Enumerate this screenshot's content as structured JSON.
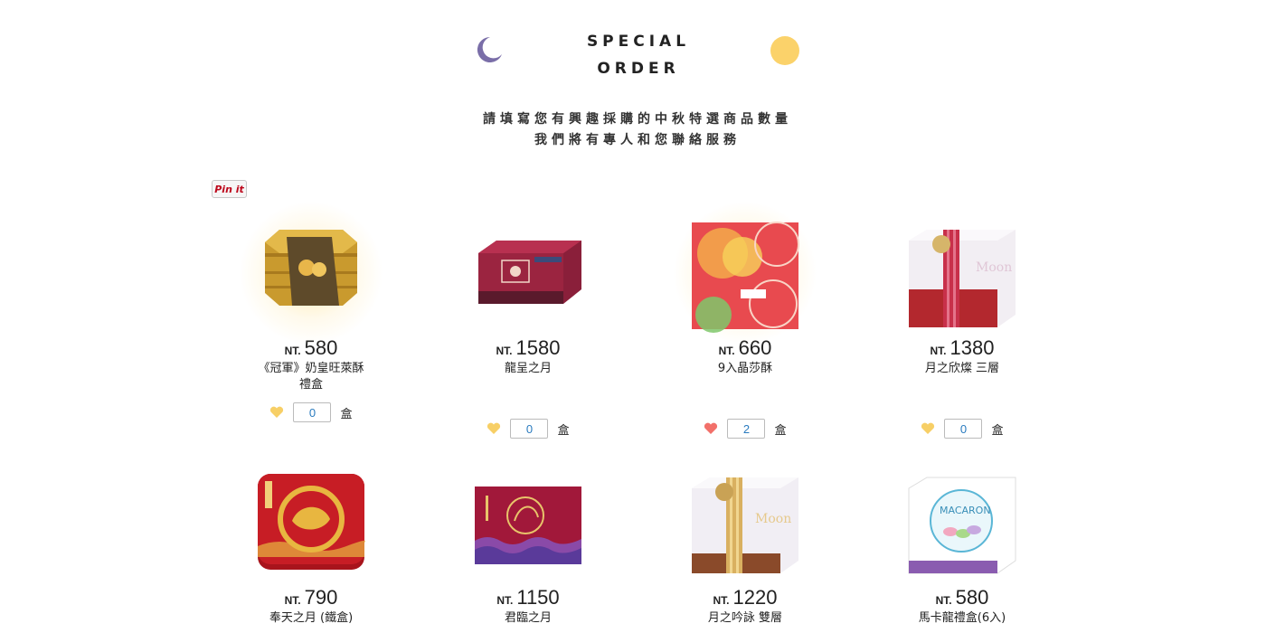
{
  "header": {
    "title_line1": "SPECIAL",
    "title_line2": "ORDER",
    "subtitle_line1": "請填寫您有興趣採購的中秋特選商品數量",
    "subtitle_line2": "我們將有專人和您聯絡服務"
  },
  "pinit_label": "Pin it",
  "price_prefix": "NT.",
  "unit_label": "盒",
  "colors": {
    "heart_default": "#f7cf66",
    "heart_selected": "#f2706a",
    "moon": "#7a6ea8",
    "sun": "#fbd26a"
  },
  "products": [
    {
      "price": "580",
      "name": "《冠軍》奶皇旺萊酥",
      "name2": "禮盒",
      "qty": "0",
      "selected": false,
      "highlight": true
    },
    {
      "price": "1580",
      "name": "龍呈之月",
      "name2": "",
      "qty": "0",
      "selected": false,
      "highlight": false
    },
    {
      "price": "660",
      "name": "9入晶莎酥",
      "name2": "",
      "qty": "2",
      "selected": true,
      "highlight": true
    },
    {
      "price": "1380",
      "name": "月之欣燦 三層",
      "name2": "",
      "qty": "0",
      "selected": false,
      "highlight": false
    },
    {
      "price": "790",
      "name": "奉天之月 (鐵盒)",
      "name2": "",
      "qty": "",
      "selected": false,
      "highlight": false
    },
    {
      "price": "1150",
      "name": "君臨之月",
      "name2": "",
      "qty": "",
      "selected": false,
      "highlight": false
    },
    {
      "price": "1220",
      "name": "月之吟詠 雙層",
      "name2": "",
      "qty": "",
      "selected": false,
      "highlight": false
    },
    {
      "price": "580",
      "name": "馬卡龍禮盒(6入)",
      "name2": "",
      "qty": "",
      "selected": false,
      "highlight": false
    }
  ]
}
